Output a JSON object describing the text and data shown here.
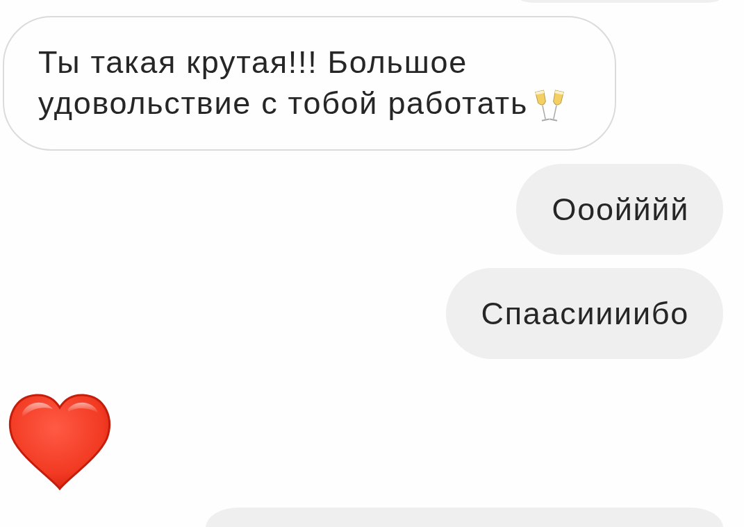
{
  "messages": [
    {
      "kind": "cut",
      "from_me": true
    },
    {
      "kind": "text",
      "from_me": false,
      "text": "Ты такая крутая!!! Большое удовольствие с тобой работать",
      "emoji_after": true
    },
    {
      "kind": "text",
      "from_me": true,
      "text": "Ооойййй",
      "emoji_after": false
    },
    {
      "kind": "text",
      "from_me": true,
      "text": "Спаасиииибо",
      "emoji_after": false
    },
    {
      "kind": "heart",
      "from_me": false
    },
    {
      "kind": "cut",
      "from_me": true
    }
  ]
}
